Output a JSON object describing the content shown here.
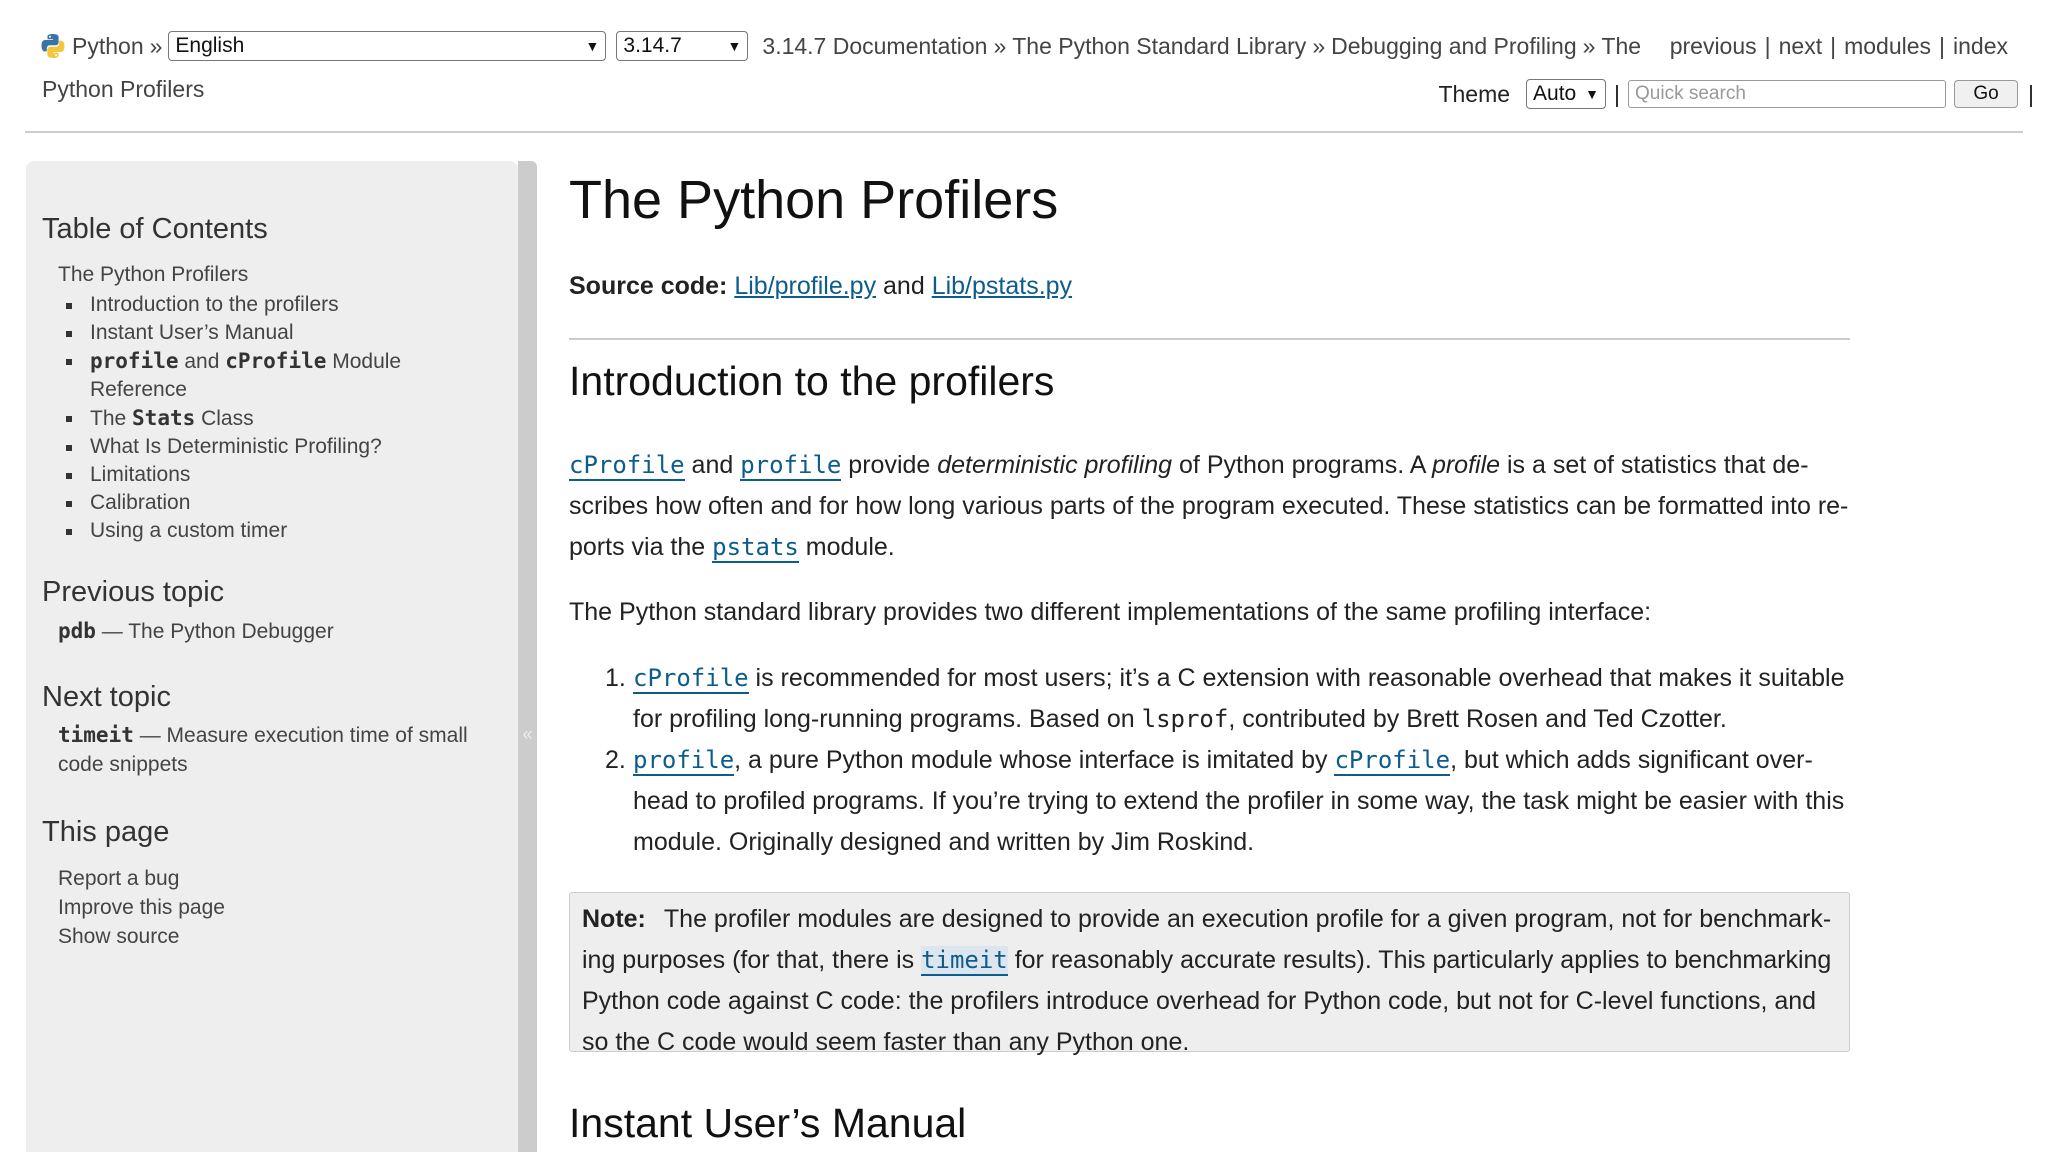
{
  "topbar": {
    "python_label": "Python",
    "crumb_sep": "»",
    "language_selected": "English",
    "version_selected": "3.14.7",
    "breadcrumb_doc": "3.14.7 Documentation",
    "breadcrumb_stdlib": "The Python Standard Library",
    "breadcrumb_debug": "Debugging and Profiling",
    "breadcrumb_page_line1": "The",
    "breadcrumb_page_line2": "Python Profilers",
    "nav_previous": "previous",
    "nav_next": "next",
    "nav_modules": "modules",
    "nav_index": "index",
    "pipe": "|",
    "theme_label": "Theme",
    "theme_selected": "Auto",
    "search_placeholder": "Quick search",
    "go_label": "Go"
  },
  "sidebar": {
    "toc_heading": "Table of Contents",
    "toc_root": "The Python Profilers",
    "toc_items": [
      {
        "text": "Introduction to the profilers"
      },
      {
        "text": "Instant User’s Manual"
      },
      {
        "code1": "profile",
        "mid": " and ",
        "code2": "cProfile",
        "tail": " Module Reference"
      },
      {
        "pre": "The ",
        "code": "Stats",
        "tail": " Class"
      },
      {
        "text": "What Is Deterministic Profiling?"
      },
      {
        "text": "Limitations"
      },
      {
        "text": "Calibration"
      },
      {
        "text": "Using a custom timer"
      }
    ],
    "prev_heading": "Previous topic",
    "prev_code": "pdb",
    "prev_text": " — The Python Debugger",
    "next_heading": "Next topic",
    "next_code": "timeit",
    "next_text": " — Measure execution time of small code snippets",
    "this_page_heading": "This page",
    "report_bug": "Report a bug",
    "improve_page": "Improve this page",
    "show_source": "Show source",
    "collapse_glyph": "«"
  },
  "main": {
    "title": "The Python Profilers",
    "source_label": "Source code:",
    "source_link1": "Lib/profile.py",
    "source_and": " and ",
    "source_link2": "Lib/pstats.py",
    "intro_heading": "Introduction to the profilers",
    "intro_p1": {
      "cprofile": "cProfile",
      "and": " and ",
      "profile": "profile",
      "provide": " provide ",
      "det_profiling": "deterministic profiling",
      "of_python": " of Python programs. A ",
      "profile_em": "profile",
      "rest": " is a set of statistics that de­scribes how often and for how long various parts of the program executed. These statistics can be formatted into re­ports via the ",
      "pstats": "pstats",
      "module": " module."
    },
    "intro_p2": "The Python standard library provides two different implementations of the same profiling interface:",
    "list": [
      {
        "num": "1.",
        "code": "cProfile",
        "text_a": " is recommended for most users; it’s a C extension with reasonable overhead that makes it suitable for profiling long-running programs. Based on ",
        "lsprof": "lsprof",
        "text_b": ", contributed by Brett Rosen and Ted Czotter."
      },
      {
        "num": "2.",
        "code": "profile",
        "text_a": ", a pure Python module whose interface is imitated by ",
        "code2": "cProfile",
        "text_b": ", but which adds significant over­head to profiled programs. If you’re trying to extend the profiler in some way, the task might be easier with this module. Originally designed and written by Jim Roskind."
      }
    ],
    "note": {
      "label": "Note:",
      "text_a": "The profiler modules are designed to provide an execution profile for a given program, not for benchmark­ing purposes (for that, there is ",
      "timeit": "timeit",
      "text_b": " for reasonably accurate results). This particularly applies to benchmarking Python code against C code: the profilers introduce overhead for Python code, but not for C-level functions, and so the C code would seem faster than any Python one."
    },
    "manual_heading": "Instant User’s Manual"
  }
}
